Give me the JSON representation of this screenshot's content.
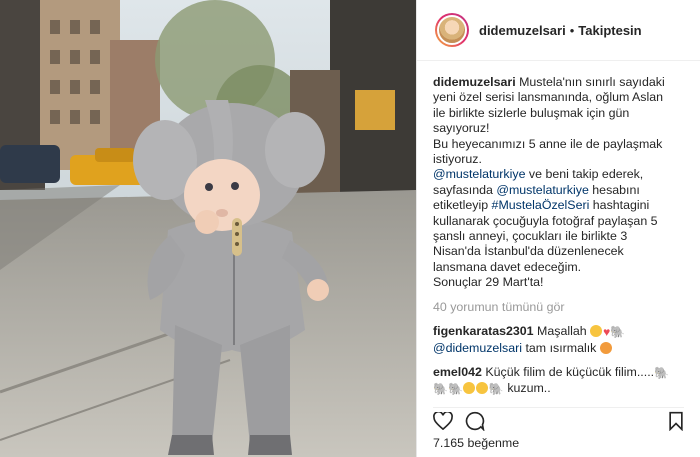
{
  "post": {
    "username": "didemuzelsari",
    "separator": "•",
    "follow_status": "Takiptesin",
    "caption": {
      "username": "didemuzelsari",
      "lines": [
        "Mustela'nın sınırlı sayıdaki",
        "yeni özel serisi lansmanında, oğlum Aslan",
        "ile birlikte sizlerle buluşmak için gün",
        "sayıyoruz!",
        "Bu heyecanımızı 5 anne ile de paylaşmak",
        "istiyoruz."
      ],
      "mention1": "@mustelaturkiye",
      "text2": " ve beni takip ederek,",
      "text3": "sayfasında ",
      "mention2": "@mustelaturkiye",
      "text4": " hesabını",
      "text5": "etiketleyip ",
      "hashtag": "#MustelaÖzelSeri",
      "text6": " hashtagini",
      "lines2": [
        "kullanarak çocuğuyla fotoğraf paylaşan 5",
        "şanslı anneyi, çocukları ile birlikte 3",
        "Nisan'da İstanbul'da düzenlenecek",
        "lansmana davet edeceğim.",
        "Sonuçlar 29 Mart'ta!"
      ]
    },
    "view_all_comments": "40 yorumun tümünü gör",
    "comments": [
      {
        "user": "figenkaratas2301",
        "text": "Maşallah",
        "reply_mention": "@didemuzelsari",
        "reply_text": " tam ısırmalık"
      },
      {
        "user": "emel042",
        "text": "Küçük filim de küçücük filim.....",
        "text2": "kuzum.."
      }
    ],
    "likes": "7.165 beğenme",
    "icons": [
      "heart-icon",
      "comment-icon",
      "bookmark-icon"
    ],
    "colors": {
      "link": "#003569",
      "muted": "#999999",
      "heart": "#ed4956"
    }
  }
}
